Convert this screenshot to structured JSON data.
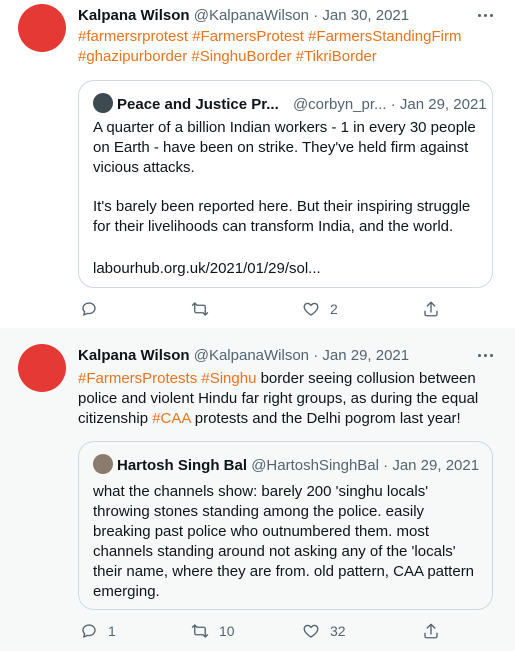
{
  "tweets": [
    {
      "author_name": "Kalpana Wilson",
      "handle": "@KalpanaWilson",
      "date": "Jan 30, 2021",
      "text_parts": [
        {
          "text": "#farmersrprotest #FarmersProtest #FarmersStandingFirm #ghazipurborder #SinghuBorder #TikriBorder",
          "tag": true
        }
      ],
      "quote": {
        "author_name": "Peace and Justice Pr...",
        "handle": "@corbyn_pr...",
        "date": "Jan 29, 2021",
        "paragraphs": [
          "A quarter of a billion Indian workers - 1 in every 30 people on Earth - have been on strike. They've held firm against vicious attacks.",
          "It's barely been reported here. But their inspiring struggle for their livelihoods can transform India, and the world.",
          "labourhub.org.uk/2021/01/29/sol..."
        ]
      },
      "actions": {
        "reply": "",
        "retweet": "",
        "like": "2"
      }
    },
    {
      "author_name": "Kalpana Wilson",
      "handle": "@KalpanaWilson",
      "date": "Jan 29, 2021",
      "text_parts": [
        {
          "text": "#FarmersProtests #Singhu",
          "tag": true
        },
        {
          "text": " border seeing collusion between police and violent  Hindu far right groups, as during the equal citizenship ",
          "tag": false
        },
        {
          "text": "#CAA",
          "tag": true
        },
        {
          "text": " protests and the Delhi pogrom last year!",
          "tag": false
        }
      ],
      "quote": {
        "author_name": "Hartosh Singh Bal",
        "handle": "@HartoshSinghBal",
        "date": "Jan 29, 2021",
        "paragraphs": [
          "what the channels show: barely 200 'singhu locals' throwing stones standing among the police. easily breaking past police who outnumbered them. most channels standing around not asking any of the 'locals' their name, where they are from. old pattern, CAA pattern emerging."
        ]
      },
      "actions": {
        "reply": "1",
        "retweet": "10",
        "like": "32"
      }
    }
  ],
  "colors": {
    "avatar": "#e53935",
    "hashtag": "#e8731f",
    "muted": "#536471",
    "border": "#cfd9de"
  },
  "icons": [
    "reply-icon",
    "retweet-icon",
    "like-icon",
    "share-icon",
    "more-icon"
  ]
}
